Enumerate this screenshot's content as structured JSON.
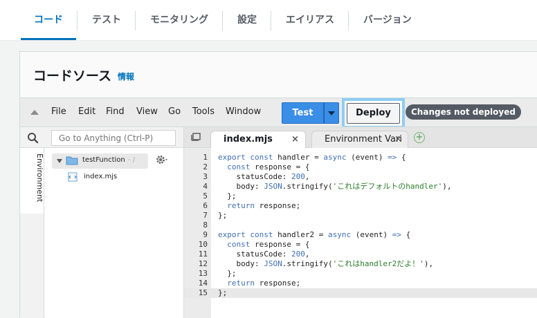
{
  "top_tabs": [
    {
      "label": "コード",
      "active": true
    },
    {
      "label": "テスト"
    },
    {
      "label": "モニタリング"
    },
    {
      "label": "設定"
    },
    {
      "label": "エイリアス"
    },
    {
      "label": "バージョン"
    }
  ],
  "panel": {
    "title": "コードソース",
    "info_link": "情報"
  },
  "menubar": {
    "items": [
      "File",
      "Edit",
      "Find",
      "View",
      "Go",
      "Tools",
      "Window"
    ],
    "test_label": "Test",
    "deploy_label": "Deploy",
    "status_badge": "Changes not deployed"
  },
  "sidebar": {
    "search_placeholder": "Go to Anything (Ctrl-P)",
    "vertical_tab": "Environment",
    "folder_name": "testFunction",
    "folder_path": "- /",
    "file_name": "index.mjs"
  },
  "editor": {
    "tabs": [
      {
        "label": "index.mjs",
        "active": true
      },
      {
        "label": "Environment Vari",
        "active": false
      }
    ],
    "close_glyph": "×",
    "add_glyph": "+",
    "active_line": 15,
    "lines": [
      {
        "n": "1",
        "text": "export const handler = async (event) => {"
      },
      {
        "n": "2",
        "text": "  const response = {"
      },
      {
        "n": "3",
        "text": "    statusCode: 200,"
      },
      {
        "n": "4",
        "text": "    body: JSON.stringify('これはデフォルトのhandler'),"
      },
      {
        "n": "5",
        "text": "  };"
      },
      {
        "n": "6",
        "text": "  return response;"
      },
      {
        "n": "7",
        "text": "};"
      },
      {
        "n": "8",
        "text": ""
      },
      {
        "n": "9",
        "text": "export const handler2 = async (event) => {"
      },
      {
        "n": "10",
        "text": "  const response = {"
      },
      {
        "n": "11",
        "text": "    statusCode: 200,"
      },
      {
        "n": "12",
        "text": "    body: JSON.stringify('これはhandler2だよ！'),"
      },
      {
        "n": "13",
        "text": "  };"
      },
      {
        "n": "14",
        "text": "  return response;"
      },
      {
        "n": "15",
        "text": "};"
      }
    ]
  },
  "colors": {
    "accent": "#0073bb",
    "test_button": "#3a8ee6",
    "deploy_highlight": "#8ecdf2",
    "badge": "#545b64"
  }
}
